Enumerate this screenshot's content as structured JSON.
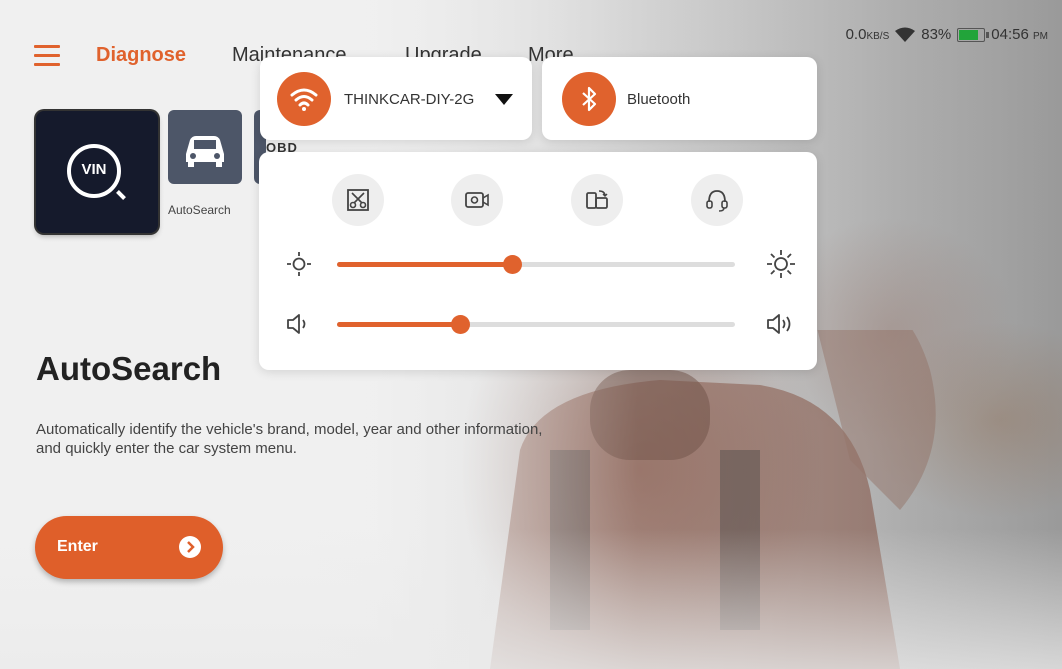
{
  "status_bar": {
    "network_speed": "0.0",
    "network_unit": "KB/S",
    "battery_percent": "83%",
    "battery_level": 0.83,
    "time": "04:56",
    "ampm": "PM"
  },
  "nav": {
    "tabs": [
      "Diagnose",
      "Maintenance",
      "Upgrade",
      "More"
    ],
    "active_tab": "Diagnose"
  },
  "tiles": {
    "vin_label": "VIN",
    "autosearch_label": "AutoSearch",
    "obd_label": "OBD"
  },
  "feature": {
    "title": "AutoSearch",
    "description": "Automatically identify the vehicle's brand, model, year and other information, and quickly enter the car system menu.",
    "enter_label": "Enter"
  },
  "quick_panel": {
    "wifi_name": "THINKCAR-DIY-2G",
    "bluetooth_label": "Bluetooth",
    "tools": [
      "screenshot-icon",
      "screen-record-icon",
      "rotate-icon",
      "headset-icon"
    ],
    "brightness_level": 0.44,
    "volume_level": 0.31
  },
  "colors": {
    "accent": "#E0622D",
    "tile_dark": "#151A2C",
    "battery_green": "#22A43A"
  }
}
